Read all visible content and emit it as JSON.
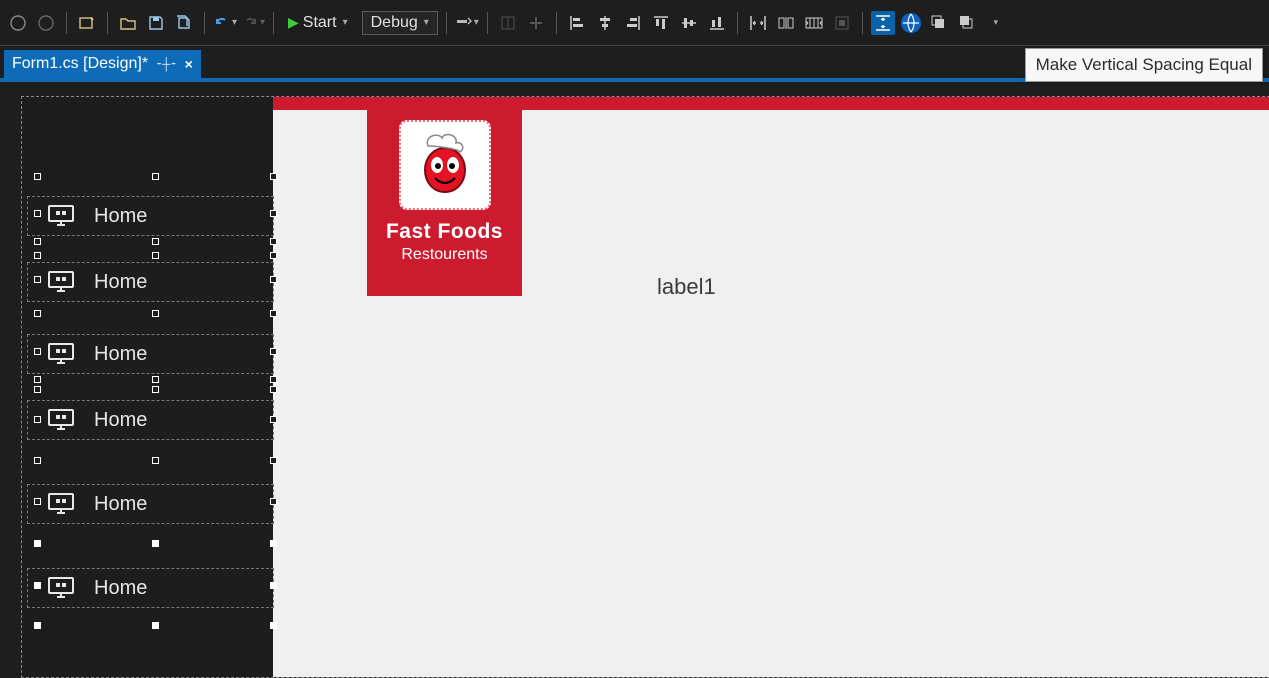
{
  "toolbar": {
    "start_label": "Start",
    "debug_label": "Debug"
  },
  "tab": {
    "title": "Form1.cs [Design]*"
  },
  "tooltip": {
    "text": "Make Vertical Spacing Equal"
  },
  "sidebar": {
    "items": [
      {
        "label": "Home"
      },
      {
        "label": "Home"
      },
      {
        "label": "Home"
      },
      {
        "label": "Home"
      },
      {
        "label": "Home"
      },
      {
        "label": "Home"
      }
    ]
  },
  "tile": {
    "title": "Fast Foods",
    "subtitle": "Restourents"
  },
  "canvas": {
    "label1": "label1"
  },
  "colors": {
    "accent": "#0e6bb8",
    "brand_red": "#cc1b2f",
    "surface_dark": "#1e1e1e"
  }
}
